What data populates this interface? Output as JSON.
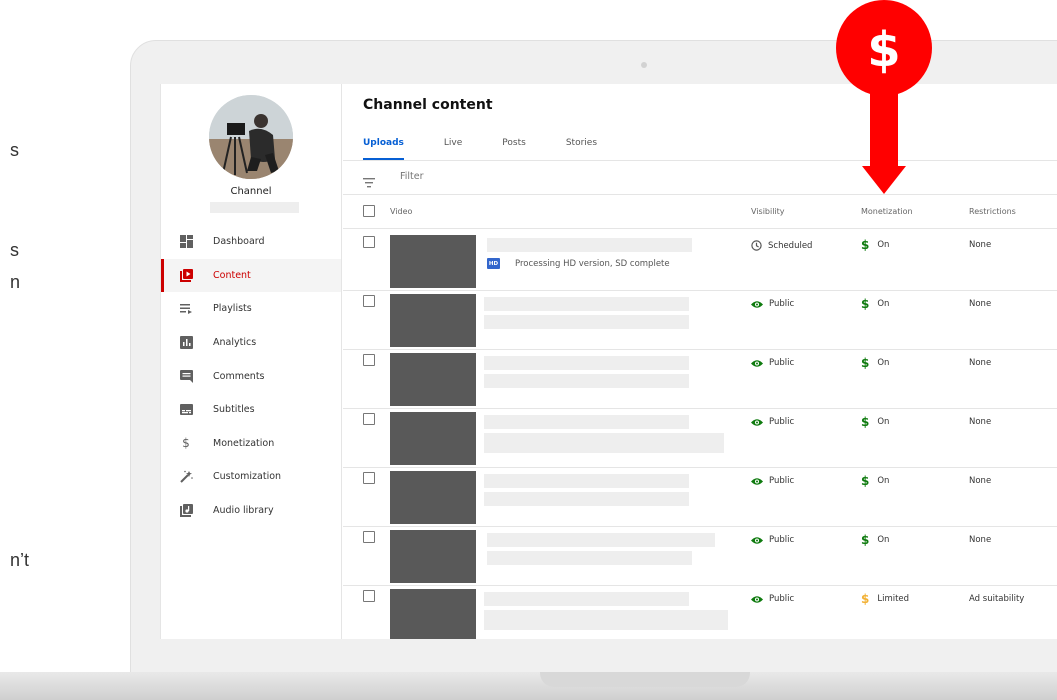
{
  "left_fragments": [
    "s",
    "s",
    "n",
    "n’t"
  ],
  "sidebar": {
    "channel_label": "Channel",
    "items": [
      {
        "label": "Dashboard",
        "icon": "dashboard-icon",
        "active": false
      },
      {
        "label": "Content",
        "icon": "content-icon",
        "active": true
      },
      {
        "label": "Playlists",
        "icon": "playlists-icon",
        "active": false
      },
      {
        "label": "Analytics",
        "icon": "analytics-icon",
        "active": false
      },
      {
        "label": "Comments",
        "icon": "comments-icon",
        "active": false
      },
      {
        "label": "Subtitles",
        "icon": "subtitles-icon",
        "active": false
      },
      {
        "label": "Monetization",
        "icon": "dollar-icon",
        "active": false
      },
      {
        "label": "Customization",
        "icon": "magic-wand-icon",
        "active": false
      },
      {
        "label": "Audio library",
        "icon": "audio-library-icon",
        "active": false
      }
    ]
  },
  "main": {
    "title": "Channel content",
    "tabs": [
      "Uploads",
      "Live",
      "Posts",
      "Stories"
    ],
    "active_tab": "Uploads",
    "filter_placeholder": "Filter",
    "columns": {
      "video": "Video",
      "visibility": "Visibility",
      "monetization": "Monetization",
      "restrictions": "Restrictions"
    },
    "rows": [
      {
        "visibility": "Scheduled",
        "visibility_icon": "clock-icon",
        "monetization": "On",
        "monetization_status": "on",
        "restrictions": "None",
        "processing": "Processing HD version, SD complete",
        "badge": "HD"
      },
      {
        "visibility": "Public",
        "visibility_icon": "eye-icon",
        "monetization": "On",
        "monetization_status": "on",
        "restrictions": "None"
      },
      {
        "visibility": "Public",
        "visibility_icon": "eye-icon",
        "monetization": "On",
        "monetization_status": "on",
        "restrictions": "None"
      },
      {
        "visibility": "Public",
        "visibility_icon": "eye-icon",
        "monetization": "On",
        "monetization_status": "on",
        "restrictions": "None"
      },
      {
        "visibility": "Public",
        "visibility_icon": "eye-icon",
        "monetization": "On",
        "monetization_status": "on",
        "restrictions": "None"
      },
      {
        "visibility": "Public",
        "visibility_icon": "eye-icon",
        "monetization": "On",
        "monetization_status": "on",
        "restrictions": "None"
      },
      {
        "visibility": "Public",
        "visibility_icon": "eye-icon",
        "monetization": "Limited",
        "monetization_status": "limited",
        "restrictions": "Ad suitability"
      }
    ]
  },
  "overlay": {
    "symbol": "$",
    "color": "#ff0000"
  },
  "colors": {
    "brand_red": "#cc0000",
    "tab_blue": "#065fd4",
    "public_green": "#0f7b0f",
    "monetization_on": "#0f7b0f",
    "monetization_limited": "#f2b134",
    "thumbnail_gray": "#595959"
  }
}
